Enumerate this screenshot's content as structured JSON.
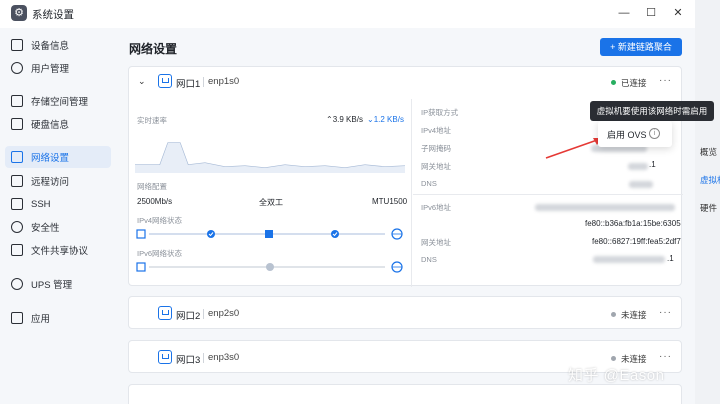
{
  "window": {
    "title": "系统设置",
    "icon": "gear-icon"
  },
  "controls": {
    "minimize": "—",
    "maximize": "☐",
    "close": "✕"
  },
  "sidebar": {
    "items": [
      {
        "label": "设备信息",
        "icon": "device-info-icon"
      },
      {
        "label": "用户管理",
        "icon": "user-icon"
      },
      {
        "label": "存储空间管理",
        "icon": "storage-icon"
      },
      {
        "label": "硬盘信息",
        "icon": "disk-icon"
      },
      {
        "label": "网络设置",
        "icon": "network-icon",
        "active": true
      },
      {
        "label": "远程访问",
        "icon": "remote-icon"
      },
      {
        "label": "SSH",
        "icon": "ssh-icon"
      },
      {
        "label": "安全性",
        "icon": "shield-icon"
      },
      {
        "label": "文件共享协议",
        "icon": "share-icon"
      },
      {
        "label": "UPS 管理",
        "icon": "ups-icon"
      },
      {
        "label": "应用",
        "icon": "apps-icon"
      }
    ]
  },
  "main": {
    "title": "网络设置",
    "new_button": "+ 新建链路聚合"
  },
  "port1": {
    "name": "网口1",
    "device": "enp1s0",
    "status": "已连接",
    "status_color": "#27ae60",
    "realtime_label": "实时速率",
    "upload": "⌃3.9 KB/s",
    "download": "⌄1.2 KB/s",
    "config_label": "网络配置",
    "speed": "2500Mb/s",
    "duplex": "全双工",
    "mtu": "MTU1500",
    "ipv4_state_label": "IPv4网络状态",
    "ipv6_state_label": "IPv6网络状态",
    "fields": {
      "ip_method": "IP获取方式",
      "ipv4": "IPv4地址",
      "subnet": "子网掩码",
      "gateway": "网关地址",
      "dns": "DNS",
      "ipv6": "IPv6地址",
      "ipv6_gateway": "网关地址",
      "ipv6_dns": "DNS"
    },
    "values": {
      "ipv6_link_local": "fe80::b36a:fb1a:15be:6305",
      "ipv6_gateway": "fe80::6827:19ff:fea5:2df7",
      "partial_1": ".1",
      "partial_2": ".1",
      "partial_3": ".1"
    }
  },
  "port2": {
    "name": "网口2",
    "device": "enp2s0",
    "status": "未连接",
    "status_color": "#a0a6ae"
  },
  "port3": {
    "name": "网口3",
    "device": "enp3s0",
    "status": "未连接",
    "status_color": "#a0a6ae"
  },
  "tooltip": "虚拟机要使用该网络时需启用",
  "menu": {
    "item": "启用 OVS",
    "info": "i"
  },
  "more": "···",
  "right_panel": {
    "items": [
      "概览",
      "虚拟机",
      "硬件"
    ]
  },
  "watermark": "知乎 @Eason",
  "accent": "#1a73e8"
}
